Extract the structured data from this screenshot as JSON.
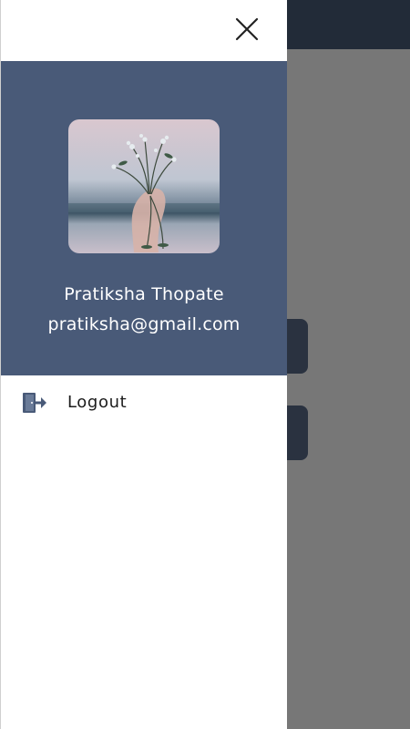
{
  "drawer": {
    "close_icon": "close-icon",
    "profile": {
      "name": "Pratiksha Thopate",
      "email": "pratiksha@gmail.com",
      "avatar_icon": "profile-photo-flowers"
    },
    "menu": [
      {
        "label": "Logout",
        "icon": "logout-icon"
      }
    ]
  },
  "colors": {
    "profile_bg": "#495a78",
    "overlay_bg": "#777777",
    "app_topbar": "#222b38"
  }
}
